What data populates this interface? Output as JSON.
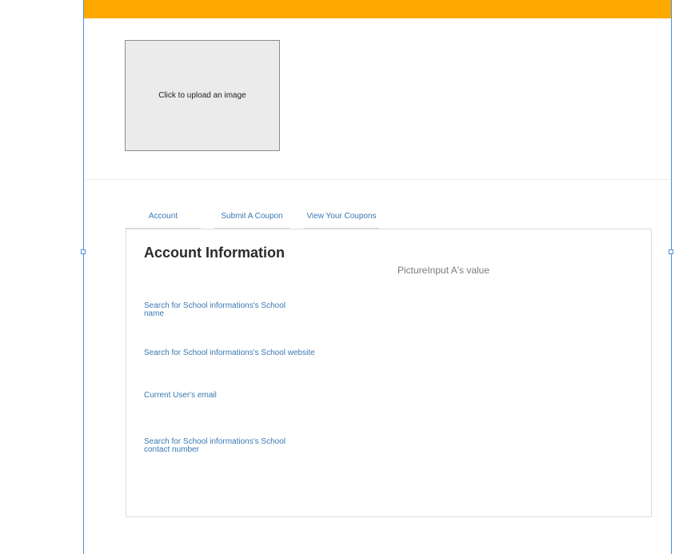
{
  "upload": {
    "label": "Click to upload an image"
  },
  "tabs": [
    {
      "label": "Account"
    },
    {
      "label": "Submit A Coupon"
    },
    {
      "label": "View Your Coupons"
    }
  ],
  "account_panel": {
    "title": "Account Information",
    "picture_value": "PictureInput A's value",
    "fields": [
      {
        "label": "Search for School informations's School name"
      },
      {
        "label": "Search for School informations's School website"
      },
      {
        "label": "Current User's email"
      },
      {
        "label": "Search for School informations's School contact number"
      }
    ]
  },
  "colors": {
    "top_bar": "#ffa800",
    "link": "#3a78b4",
    "selection": "#4a90d9"
  }
}
